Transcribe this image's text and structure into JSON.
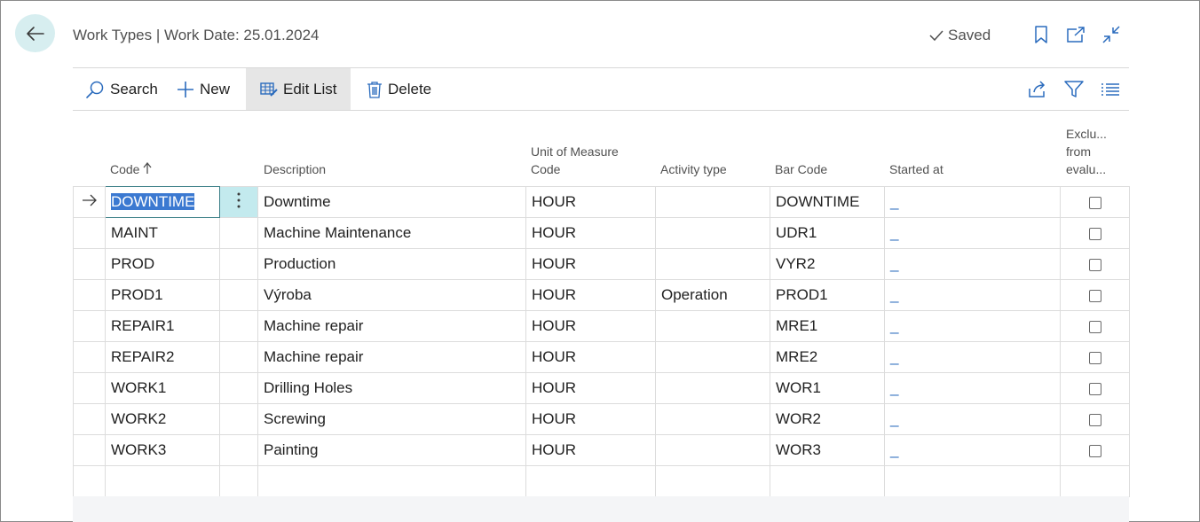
{
  "header": {
    "title": "Work Types | Work Date: 25.01.2024",
    "saved_label": "Saved"
  },
  "actions": {
    "search": "Search",
    "new": "New",
    "edit_list": "Edit List",
    "delete": "Delete"
  },
  "columns": {
    "code": "Code",
    "description": "Description",
    "uom_line1": "Unit of Measure",
    "uom_line2": "Code",
    "activity_type": "Activity type",
    "bar_code": "Bar Code",
    "started_at": "Started at",
    "excl_line1": "Exclu...",
    "excl_line2": "from",
    "excl_line3": "evalu..."
  },
  "rows": [
    {
      "code": "DOWNTIME",
      "description": "Downtime",
      "uom": "HOUR",
      "activity": "",
      "bar": "DOWNTIME",
      "started": "_",
      "excluded": false
    },
    {
      "code": "MAINT",
      "description": "Machine Maintenance",
      "uom": "HOUR",
      "activity": "",
      "bar": "UDR1",
      "started": "_",
      "excluded": false
    },
    {
      "code": "PROD",
      "description": "Production",
      "uom": "HOUR",
      "activity": "",
      "bar": "VYR2",
      "started": "_",
      "excluded": false
    },
    {
      "code": "PROD1",
      "description": "Výroba",
      "uom": "HOUR",
      "activity": "Operation",
      "bar": "PROD1",
      "started": "_",
      "excluded": false
    },
    {
      "code": "REPAIR1",
      "description": "Machine repair",
      "uom": "HOUR",
      "activity": "",
      "bar": "MRE1",
      "started": "_",
      "excluded": false
    },
    {
      "code": "REPAIR2",
      "description": "Machine repair",
      "uom": "HOUR",
      "activity": "",
      "bar": "MRE2",
      "started": "_",
      "excluded": false
    },
    {
      "code": "WORK1",
      "description": "Drilling Holes",
      "uom": "HOUR",
      "activity": "",
      "bar": "WOR1",
      "started": "_",
      "excluded": false
    },
    {
      "code": "WORK2",
      "description": "Screwing",
      "uom": "HOUR",
      "activity": "",
      "bar": "WOR2",
      "started": "_",
      "excluded": false
    },
    {
      "code": "WORK3",
      "description": "Painting",
      "uom": "HOUR",
      "activity": "",
      "bar": "WOR3",
      "started": "_",
      "excluded": false
    }
  ],
  "icons": {
    "back": "arrow-left-icon",
    "saved": "checkmark-icon",
    "bookmark": "bookmark-icon",
    "open_new": "open-in-new-window-icon",
    "collapse": "collapse-icon",
    "search": "search-icon",
    "new": "plus-icon",
    "edit_list": "edit-list-icon",
    "delete": "trash-icon",
    "share": "share-icon",
    "filter": "filter-icon",
    "list_view": "list-view-icon",
    "row_arrow": "arrow-right-icon",
    "row_menu": "more-vertical-icon"
  },
  "colors": {
    "accent": "#00a4a6",
    "back_bg": "#d7eef0",
    "selection": "#3b79d1",
    "menu_cell": "#c3eaee"
  }
}
